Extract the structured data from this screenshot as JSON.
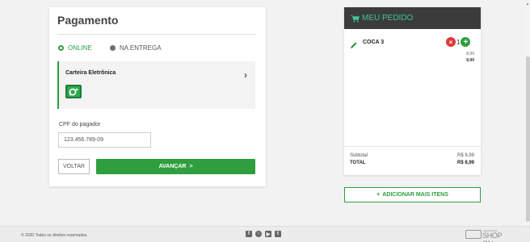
{
  "payment": {
    "title": "Pagamento",
    "option_online": "ONLINE",
    "option_delivery": "NA ENTREGA",
    "wallet_label": "Carteira Eletrônica",
    "cpf_label": "CPF do pagador",
    "cpf_value": "123.456.789-09",
    "back_button": "VOLTAR",
    "next_button": "AVANÇAR",
    "next_chevron": ">"
  },
  "order": {
    "header": "MEU PEDIDO",
    "items": [
      {
        "name": "COCA 3",
        "quantity": "1",
        "unit_price": "8,99",
        "total": "8,99"
      }
    ],
    "subtotal_label": "Subtotal",
    "subtotal_value": "R$ 8,99",
    "total_label": "TOTAL",
    "total_value": "R$ 8,99",
    "add_more_button": "ADICIONAR MAIS ITENS"
  },
  "footer": {
    "copyright": "© 2020 Todos os direitos reservados.",
    "powered_small": "desenvolvido",
    "powered_brand": "SHOP ON"
  },
  "colors": {
    "accent_green": "#2f9e3e",
    "header_dark": "#3b3b3b",
    "header_text": "#3ec39b",
    "remove_red": "#e03838"
  },
  "icons": [
    "pencil-icon",
    "cart-icon",
    "remove-icon",
    "add-icon",
    "chevron-right-icon",
    "facebook-icon",
    "instagram-icon",
    "youtube-icon",
    "twitter-icon"
  ]
}
